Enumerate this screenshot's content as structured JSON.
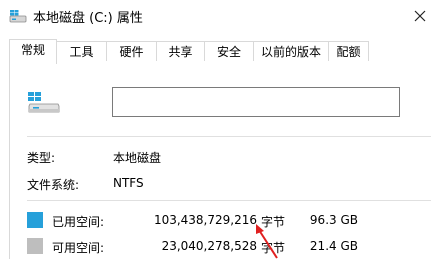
{
  "window": {
    "title": "本地磁盘 (C:) 属性",
    "close_icon": "close-icon"
  },
  "tabs": [
    {
      "label": "常规",
      "active": true
    },
    {
      "label": "工具",
      "active": false
    },
    {
      "label": "硬件",
      "active": false
    },
    {
      "label": "共享",
      "active": false
    },
    {
      "label": "安全",
      "active": false
    },
    {
      "label": "以前的版本",
      "active": false
    },
    {
      "label": "配额",
      "active": false
    }
  ],
  "general": {
    "drive_icon": "drive-icon",
    "volume_name": "",
    "type_label": "类型:",
    "type_value": "本地磁盘",
    "fs_label": "文件系统:",
    "fs_value": "NTFS"
  },
  "space": {
    "used": {
      "label": "已用空间:",
      "bytes": "103,438,729,216",
      "unit": "字节",
      "size": "96.3 GB",
      "color": "#26a0da"
    },
    "free": {
      "label": "可用空间:",
      "bytes": "23,040,278,528",
      "unit": "字节",
      "size": "21.4 GB",
      "color": "#bebebe"
    }
  },
  "annotation": {
    "color": "#e02020"
  }
}
